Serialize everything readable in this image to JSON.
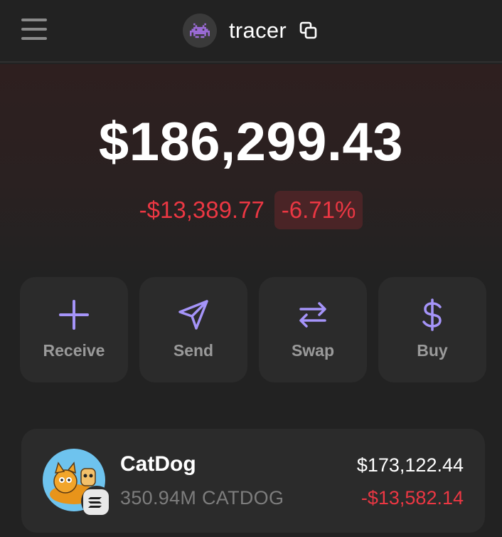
{
  "header": {
    "account_name": "tracer",
    "avatar_icon": "space-invader-icon",
    "menu_icon": "hamburger-menu-icon",
    "copy_icon": "copy-icon"
  },
  "portfolio": {
    "balance": "$186,299.43",
    "change_amount": "-$13,389.77",
    "change_percent": "-6.71%",
    "negative_color": "#eb3743"
  },
  "actions": [
    {
      "label": "Receive",
      "icon": "plus-icon"
    },
    {
      "label": "Send",
      "icon": "send-icon"
    },
    {
      "label": "Swap",
      "icon": "swap-arrows-icon"
    },
    {
      "label": "Buy",
      "icon": "dollar-icon"
    }
  ],
  "accent_color": "#a594f9",
  "tokens": [
    {
      "name": "CatDog",
      "quantity": "350.94M CATDOG",
      "value": "$173,122.44",
      "change": "-$13,582.14",
      "network_icon": "solana-badge-icon"
    }
  ]
}
